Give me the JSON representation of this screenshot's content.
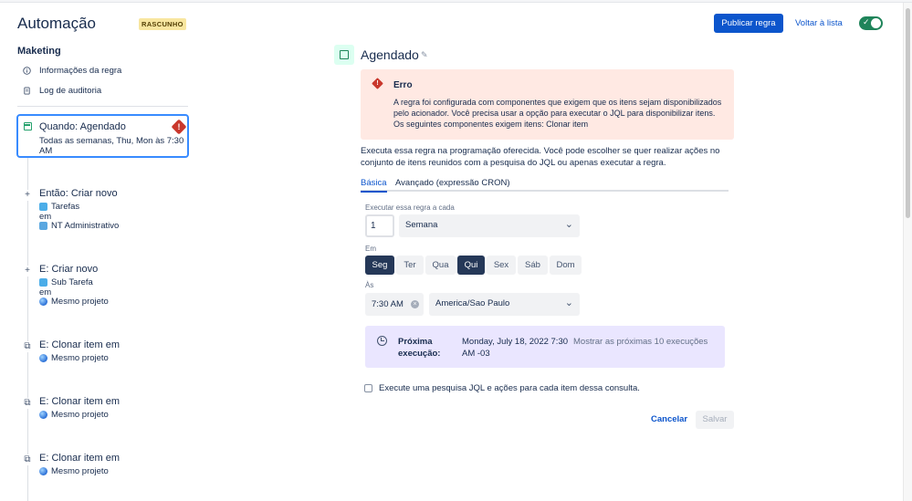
{
  "header": {
    "title": "Automação",
    "status_badge": "RASCUNHO",
    "publish_label": "Publicar regra",
    "back_label": "Voltar à lista",
    "toggle_check": "✓"
  },
  "sidebar": {
    "project_name": "Maketing",
    "nav": [
      {
        "label": "Informações da regra",
        "icon": "info-icon"
      },
      {
        "label": "Log de auditoria",
        "icon": "document-icon"
      }
    ],
    "trigger": {
      "title": "Quando: Agendado",
      "subtitle": "Todas as semanas, Thu, Mon às 7:30 AM",
      "warning_glyph": "!"
    },
    "steps": [
      {
        "title": "Então: Criar novo",
        "icon_glyph": "+",
        "line1": "Tarefas",
        "line2": "em",
        "line3": "NT Administrativo"
      },
      {
        "title": "E: Criar novo",
        "icon_glyph": "+",
        "line1": "Sub Tarefa",
        "line2": "em",
        "line3": "Mesmo projeto"
      },
      {
        "title": "E: Clonar item em",
        "icon_glyph": "⧉",
        "line1": "Mesmo projeto"
      },
      {
        "title": "E: Clonar item em",
        "icon_glyph": "⧉",
        "line1": "Mesmo projeto"
      },
      {
        "title": "E: Clonar item em",
        "icon_glyph": "⧉",
        "line1": "Mesmo projeto"
      }
    ]
  },
  "main": {
    "title": "Agendado",
    "error": {
      "title": "Erro",
      "glyph": "!",
      "text": "A regra foi configurada com componentes que exigem que os itens sejam disponibilizados pelo acionador. Você precisa usar a opção para executar o JQL para disponibilizar itens. Os seguintes componentes exigem itens: Clonar item"
    },
    "description": "Executa essa regra na programação oferecida. Você pode escolher se quer realizar ações no conjunto de itens reunidos com a pesquisa do JQL ou apenas executar a regra.",
    "tabs": [
      "Básica",
      "Avançado (expressão CRON)"
    ],
    "every_label": "Executar essa regra a cada",
    "every_value": "1",
    "period_value": "Semana",
    "on_label": "Em",
    "days": [
      {
        "label": "Seg",
        "selected": true
      },
      {
        "label": "Ter",
        "selected": false
      },
      {
        "label": "Qua",
        "selected": false
      },
      {
        "label": "Qui",
        "selected": true
      },
      {
        "label": "Sex",
        "selected": false
      },
      {
        "label": "Sáb",
        "selected": false
      },
      {
        "label": "Dom",
        "selected": false
      }
    ],
    "at_label": "Às",
    "time_value": "7:30 AM",
    "clear_glyph": "×",
    "timezone_value": "America/Sao Paulo",
    "next_run": {
      "label": "Próxima execução:",
      "value": "Monday, July 18, 2022 7:30 AM -03",
      "link": "Mostrar as próximas 10 execuções"
    },
    "jql_checkbox_label": "Execute uma pesquisa JQL e ações para cada item dessa consulta.",
    "cancel_label": "Cancelar",
    "save_label": "Salvar"
  },
  "colors": {
    "primary": "#0c55cc",
    "error_bg": "#ffe9e3",
    "next_bg": "#eae6ff",
    "selected_day": "#253858",
    "toggle_on": "#1f845a"
  }
}
